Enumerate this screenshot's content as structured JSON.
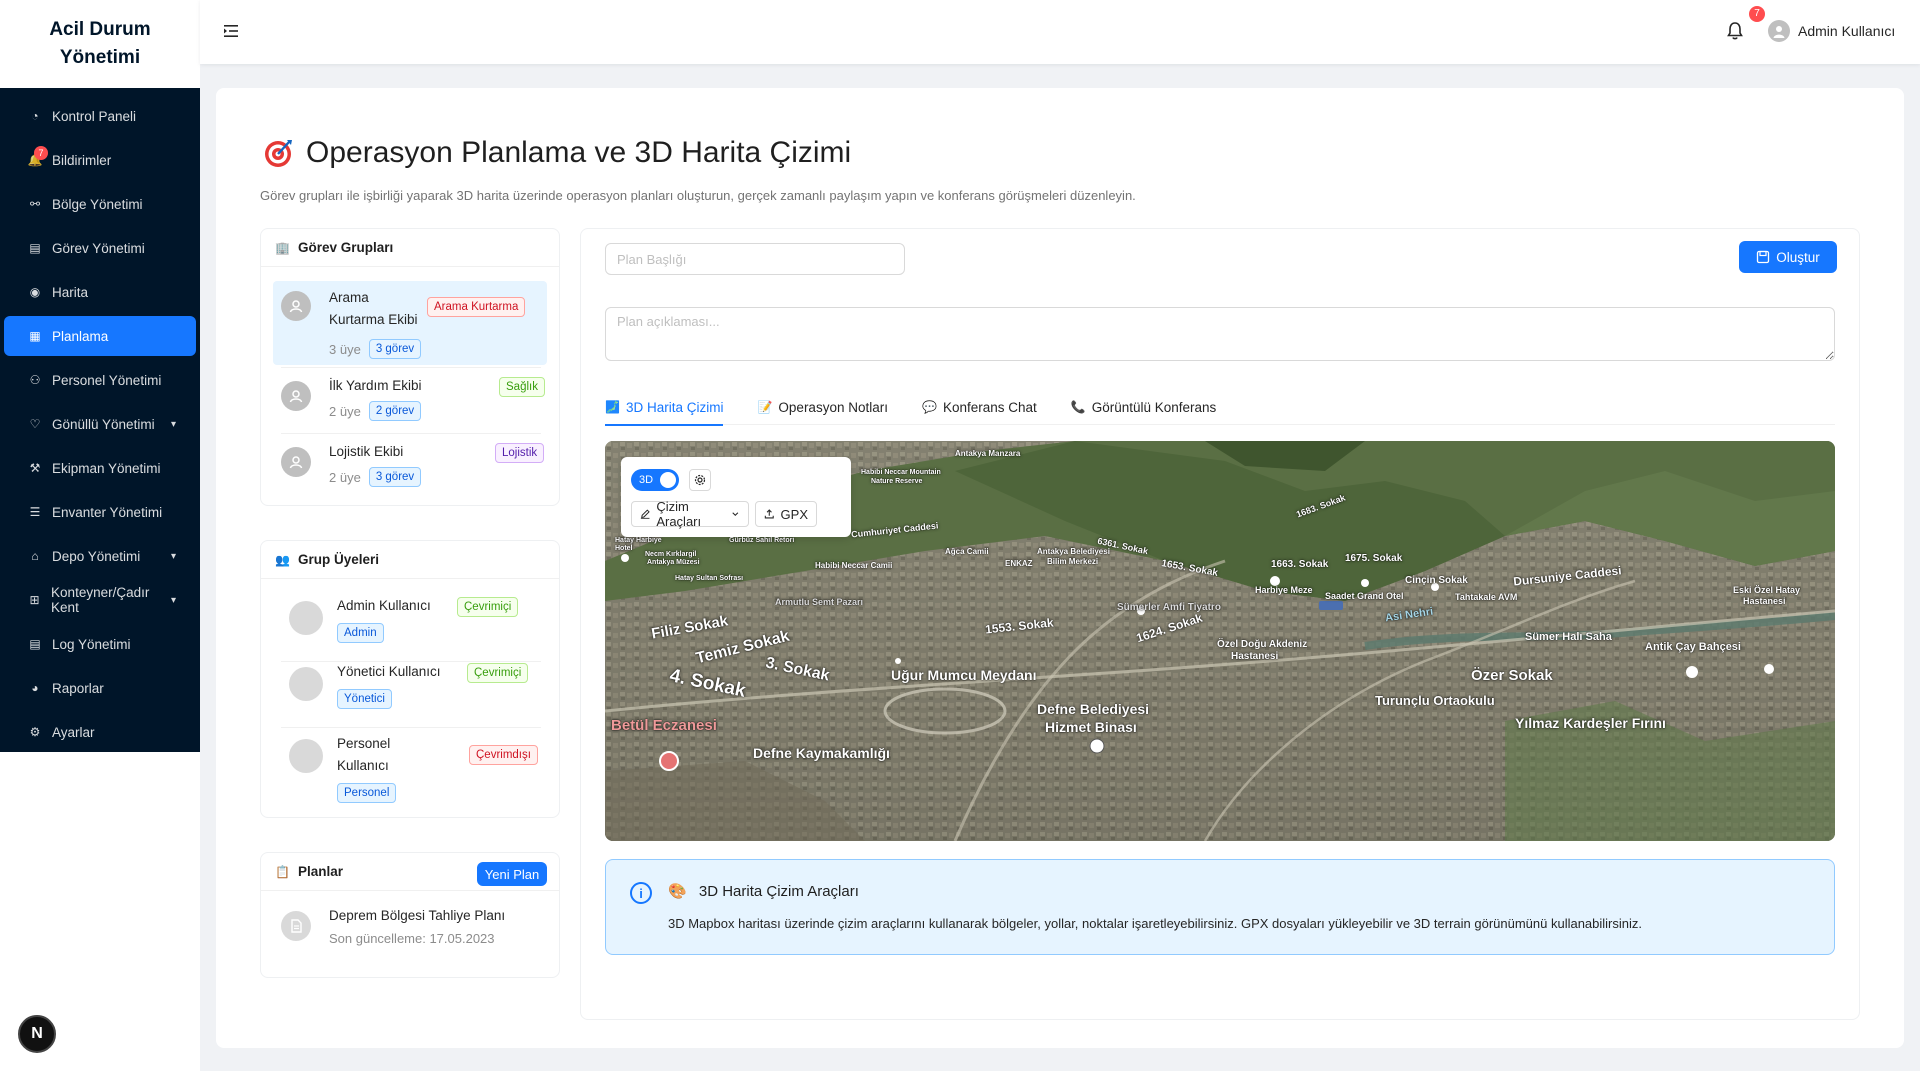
{
  "brand": {
    "line1": "Acil Durum",
    "line2": "Yönetimi"
  },
  "sidebar": {
    "items": [
      {
        "label": "Kontrol Paneli",
        "icon": "dashboard-icon"
      },
      {
        "label": "Bildirimler",
        "icon": "bell-icon",
        "badge": "7"
      },
      {
        "label": "Bölge Yönetimi",
        "icon": "cluster-icon"
      },
      {
        "label": "Görev Yönetimi",
        "icon": "file-icon"
      },
      {
        "label": "Harita",
        "icon": "location-icon"
      },
      {
        "label": "Planlama",
        "icon": "calendar-icon"
      },
      {
        "label": "Personel Yönetimi",
        "icon": "team-icon"
      },
      {
        "label": "Gönüllü Yönetimi",
        "icon": "heart-icon",
        "has_chevron": true
      },
      {
        "label": "Ekipman Yönetimi",
        "icon": "tool-icon"
      },
      {
        "label": "Envanter Yönetimi",
        "icon": "inventory-icon"
      },
      {
        "label": "Depo Yönetimi",
        "icon": "home-icon",
        "has_chevron": true
      },
      {
        "label": "Konteyner/Çadır Kent",
        "icon": "appstore-icon",
        "has_chevron": true
      },
      {
        "label": "Log Yönetimi",
        "icon": "file-text-icon"
      },
      {
        "label": "Raporlar",
        "icon": "pie-chart-icon"
      },
      {
        "label": "Ayarlar",
        "icon": "setting-icon"
      }
    ],
    "active_index": 5,
    "footer_badge": "N"
  },
  "header": {
    "notification_count": "7",
    "user_name": "Admin Kullanıcı"
  },
  "page": {
    "title": "Operasyon Planlama ve 3D Harita Çizimi",
    "description": "Görev grupları ile işbirliği yaparak 3D harita üzerinde operasyon planları oluşturun, gerçek zamanlı paylaşım yapın ve konferans görüşmeleri düzenleyin."
  },
  "groups": {
    "title": "Görev Grupları",
    "items": [
      {
        "name_line1": "Arama",
        "name_line2": "Kurtarma Ekibi",
        "tag": "Arama Kurtarma",
        "members": "3 üye",
        "tasks": "3 görev"
      },
      {
        "name_line1": "İlk Yardım Ekibi",
        "tag": "Sağlık",
        "members": "2 üye",
        "tasks": "2 görev"
      },
      {
        "name_line1": "Lojistik Ekibi",
        "tag": "Lojistik",
        "members": "2 üye",
        "tasks": "3 görev"
      }
    ]
  },
  "members": {
    "title": "Grup Üyeleri",
    "items": [
      {
        "name_line1": "Admin Kullanıcı",
        "status": "Çevrimiçi",
        "role": "Admin"
      },
      {
        "name_line1": "Yönetici Kullanıcı",
        "status": "Çevrimiçi",
        "role": "Yönetici"
      },
      {
        "name_line1": "Personel",
        "name_line2": "Kullanıcı",
        "status": "Çevrimdışı",
        "role": "Personel"
      }
    ]
  },
  "plans": {
    "title": "Planlar",
    "new_button": "Yeni Plan",
    "items": [
      {
        "name": "Deprem Bölgesi Tahliye Planı",
        "updated": "Son güncelleme: 17.05.2023"
      }
    ]
  },
  "editor": {
    "title_placeholder": "Plan Başlığı",
    "desc_placeholder": "Plan açıklaması...",
    "create_button": "Oluştur",
    "tabs": [
      {
        "label": "3D Harita Çizimi",
        "icon": "map-icon"
      },
      {
        "label": "Operasyon Notları",
        "icon": "memo-icon"
      },
      {
        "label": "Konferans Chat",
        "icon": "chat-icon"
      },
      {
        "label": "Görüntülü Konferans",
        "icon": "video-call-icon"
      }
    ],
    "active_tab": 0
  },
  "map": {
    "toggle_label": "3D",
    "draw_tools": "Çizim Araçları",
    "gpx": "GPX",
    "labels": [
      "Filiz Sokak",
      "Temiz Sokak",
      "3. Sokak",
      "4. Sokak",
      "Betül Eczanesi",
      "Uğur Mumcu Meydanı",
      "Defne Belediyesi",
      "Hizmet Binası",
      "Defne Kaymakamlığı",
      "Özer Sokak",
      "Turunçlu Ortaokulu",
      "Yılmaz Kardeşler Fırını",
      "Antik Çay Bahçesi",
      "Sümer Halı Saha",
      "Dursuniye Caddesi",
      "1624. Sokak",
      "1553. Sokak",
      "Özel Doğu Akdeniz",
      "Hastanesi",
      "1675. Sokak",
      "Cinçin Sokak",
      "Harbiye Meze",
      "1663. Sokak",
      "1653. Sokak",
      "6361. Sokak",
      "Armutlu Semt Pazarı",
      "Sümerler Amfi Tiyatro",
      "Saadet Grand Otel",
      "Tahtakale AVM",
      "Asi Nehri",
      "Habibi Neccar Camii",
      "Ağca Camii",
      "ENKAZ",
      "Antakya Belediyesi",
      "Bilim Merkezi",
      "Eski Özel Hatay",
      "Hastanesi",
      "Antakya Manzara",
      "Habibi Neccar Mountain",
      "Nature Reserve",
      "Cumhuriyet Caddesi",
      "1683. Sokak",
      "Necm Kırklargil",
      "Antakya Müzesi",
      "Hatay Sultan Sofrası",
      "Gürbüz Sahil Retori",
      "Hatay Harbiye",
      "Hotel"
    ]
  },
  "info": {
    "title": "3D Harita Çizim Araçları",
    "text": "3D Mapbox haritası üzerinde çizim araçlarını kullanarak bölgeler, yollar, noktalar işaretleyebilirsiniz. GPX dosyaları yükleyebilir ve 3D terrain görünümünü kullanabilirsiniz."
  },
  "colors": {
    "primary": "#1677ff",
    "sidebar_bg": "#001529",
    "danger": "#ff4d4f"
  }
}
